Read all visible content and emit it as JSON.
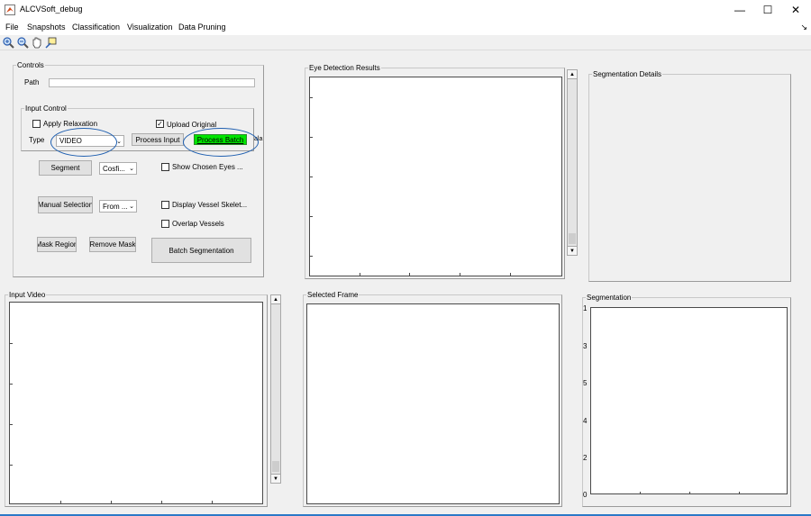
{
  "window": {
    "title": "ALCVSoft_debug",
    "controls": [
      "—",
      "☐",
      "✕"
    ]
  },
  "menu": [
    "File",
    "Snapshots",
    "Classification",
    "Visualization",
    "Data Pruning"
  ],
  "toolbar_icons": [
    "zoom-in-icon",
    "zoom-out-icon",
    "pan-hand-icon",
    "data-cursor-icon"
  ],
  "controls": {
    "title": "Controls",
    "path_label": "Path",
    "path_value": "",
    "input_control": {
      "title": "Input Control",
      "apply_relaxation": {
        "label": "Apply Relaxation",
        "checked": false
      },
      "upload_original": {
        "label": "Upload Original",
        "checked": true
      },
      "type_label": "Type",
      "type_value": "VIDEO",
      "process_input": "Process Input",
      "process_batch": "Process Batch",
      "truncated_text": "ala"
    },
    "segment": "Segment",
    "segment_method": "Cosfi...",
    "show_chosen_eyes": "Show Chosen Eyes ...",
    "manual_selection": "Manual Selection",
    "from_value": "From ...",
    "display_vessel": "Display Vessel Skelet...",
    "overlap_vessels": "Overlap Vessels",
    "mask_region": "Mask Region",
    "remove_mask": "Remove Mask",
    "batch_segmentation": "Batch Segmentation"
  },
  "panels": {
    "eye_detection": "Eye Detection Results",
    "segmentation_details": "Segmentation Details",
    "input_video": "Input Video",
    "selected_frame": "Selected Frame",
    "segmentation": "Segmentation"
  },
  "segmentation_axis": {
    "y_ticks": [
      "1",
      "3",
      "5",
      "4",
      "2",
      "0"
    ]
  },
  "colors": {
    "process_batch_bg": "#00e400",
    "highlight_ellipse": "#1f5fb0"
  }
}
